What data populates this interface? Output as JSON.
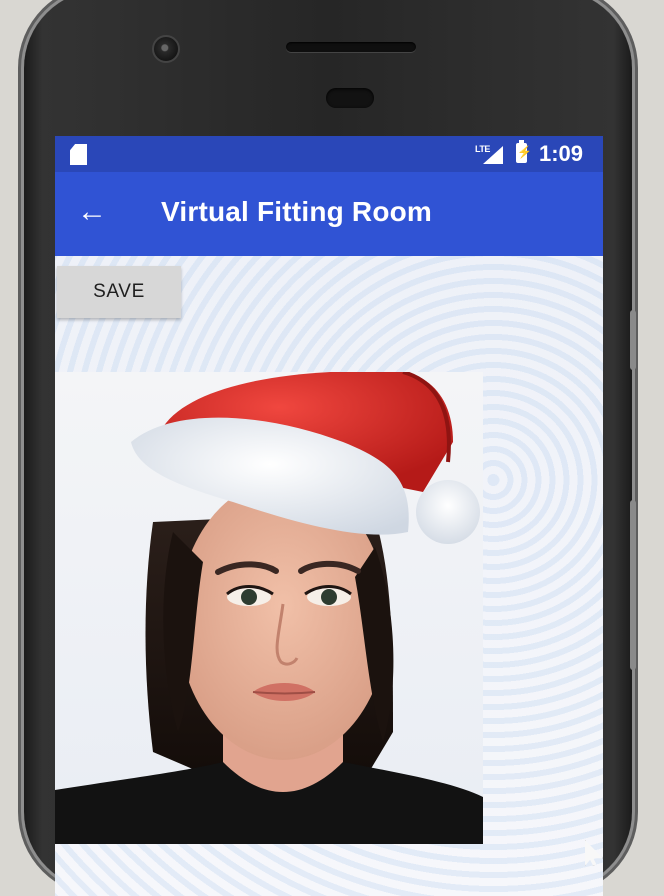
{
  "status_bar": {
    "network": "LTE",
    "time": "1:09",
    "icons": [
      "sd-card-icon",
      "signal-icon",
      "battery-charging-icon"
    ]
  },
  "app_bar": {
    "back_icon": "arrow-left-icon",
    "back_glyph": "←",
    "title": "Virtual Fitting Room",
    "color": "#3053d4",
    "status_color": "#2a47b8"
  },
  "main": {
    "save_label": "SAVE",
    "photo_description": "woman portrait with santa hat overlay"
  }
}
